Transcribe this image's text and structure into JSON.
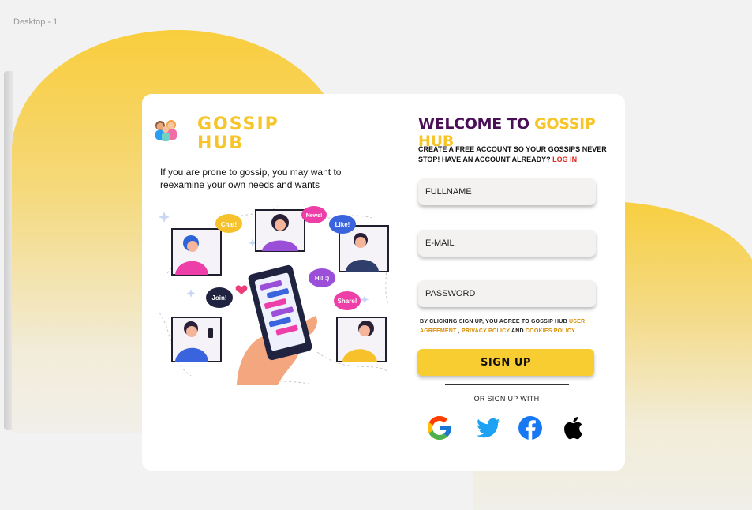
{
  "frame": {
    "label": "Desktop - 1"
  },
  "brand": {
    "line1": "GOSSIP",
    "line2": "HUB"
  },
  "tagline": "If you are prone to gossip, you may want to reexamine your own needs and wants",
  "illustration": {
    "bubbles": [
      "Chat!",
      "News!",
      "Like!",
      "Hi! :)",
      "Join!",
      "Share!"
    ]
  },
  "welcome": {
    "part1": "WELCOME TO ",
    "part2": "GOSSIP HUB"
  },
  "subtext": {
    "text": "CREATE A FREE ACCOUNT SO YOUR GOSSIPS NEVER STOP! HAVE AN ACCOUNT ALREADY? ",
    "login_link": "LOG IN"
  },
  "form": {
    "fullname_placeholder": "FULLNAME",
    "email_placeholder": "E-MAIL",
    "password_placeholder": "PASSWORD"
  },
  "terms": {
    "prefix": "BY CLICKING SIGN UP, YOU AGREE TO GOSSIP HUB ",
    "user_agreement": "USER AGREEMENT",
    "sep": " , ",
    "privacy": "PRIVACY POLICY",
    "and": " AND ",
    "cookies": "COOKIES POLICY"
  },
  "signup_label": "SIGN UP",
  "or_text": "OR SIGN UP WITH",
  "social": [
    "google-icon",
    "twitter-icon",
    "facebook-icon",
    "apple-icon"
  ],
  "colors": {
    "accent_yellow": "#f7c52a",
    "welcome_purple": "#4a0f57",
    "login_red": "#e0251f",
    "terms_link": "#d98c00"
  }
}
